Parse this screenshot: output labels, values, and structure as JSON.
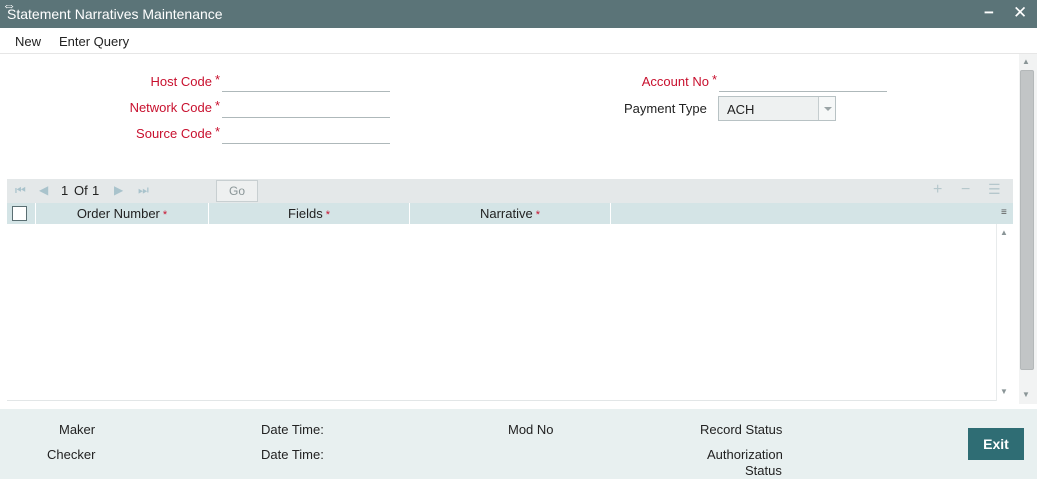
{
  "window": {
    "title": "Statement Narratives Maintenance",
    "minimize": "−",
    "close": "✕"
  },
  "menu": {
    "new": "New",
    "enter_query": "Enter Query"
  },
  "form": {
    "host_code_label": "Host Code",
    "network_code_label": "Network Code",
    "source_code_label": "Source Code",
    "account_no_label": "Account No",
    "payment_type_label": "Payment Type",
    "payment_type_value": "ACH",
    "required_marker": "*",
    "host_code_value": "",
    "network_code_value": "",
    "source_code_value": "",
    "account_no_value": ""
  },
  "grid": {
    "page_current": "1",
    "page_of": "Of",
    "page_total": "1",
    "go_label": "Go",
    "columns": [
      {
        "label": "Order Number",
        "required": "*"
      },
      {
        "label": "Fields",
        "required": "*"
      },
      {
        "label": "Narrative",
        "required": "*"
      }
    ],
    "rows": []
  },
  "footer": {
    "maker_label": "Maker",
    "checker_label": "Checker",
    "date_time_label_1": "Date Time:",
    "date_time_label_2": "Date Time:",
    "mod_no_label": "Mod No",
    "record_status_label": "Record Status",
    "authorization_label": "Authorization",
    "status_label": "Status",
    "exit_label": "Exit"
  },
  "colors": {
    "titlebar": "#5b7478",
    "required_red": "#c8102e",
    "grid_header": "#d4e4e6",
    "footer_bg": "#e8f0f0",
    "exit_button": "#2f6d74"
  }
}
